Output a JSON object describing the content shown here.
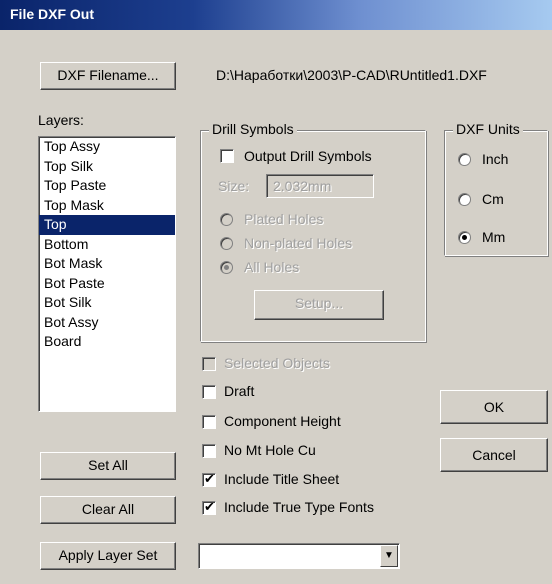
{
  "window": {
    "title": "File DXF Out"
  },
  "dxf_filename_button": "DXF Filename...",
  "dxf_filename_path": "D:\\Наработки\\2003\\P-CAD\\RUntitled1.DXF",
  "layers": {
    "label": "Layers:",
    "items": [
      "Top Assy",
      "Top Silk",
      "Top Paste",
      "Top Mask",
      "Top",
      "Bottom",
      "Bot Mask",
      "Bot Paste",
      "Bot Silk",
      "Bot Assy",
      "Board"
    ],
    "selected": "Top"
  },
  "drill_symbols": {
    "legend": "Drill Symbols",
    "output_label": "Output Drill Symbols",
    "output_checked": false,
    "size_label": "Size:",
    "size_value": "2.032mm",
    "plated_label": "Plated Holes",
    "nonplated_label": "Non-plated Holes",
    "all_label": "All Holes",
    "selected_hole_option": "All Holes",
    "setup_label": "Setup..."
  },
  "dxf_units": {
    "legend": "DXF Units",
    "inch_label": "Inch",
    "cm_label": "Cm",
    "mm_label": "Mm",
    "selected": "Mm"
  },
  "options": {
    "selected_objects_label": "Selected Objects",
    "selected_objects_checked": false,
    "draft_label": "Draft",
    "draft_checked": false,
    "component_height_label": "Component Height",
    "component_height_checked": false,
    "no_mt_hole_cu_label": "No Mt Hole Cu",
    "no_mt_hole_cu_checked": false,
    "include_title_sheet_label": "Include Title Sheet",
    "include_title_sheet_checked": true,
    "include_true_type_fonts_label": "Include True Type Fonts",
    "include_true_type_fonts_checked": true
  },
  "buttons": {
    "ok": "OK",
    "cancel": "Cancel",
    "set_all": "Set All",
    "clear_all": "Clear All",
    "apply_layer_set": "Apply Layer Set"
  },
  "layer_set_value": "",
  "icons": {
    "check": "✔",
    "combo_arrow": "▼"
  }
}
